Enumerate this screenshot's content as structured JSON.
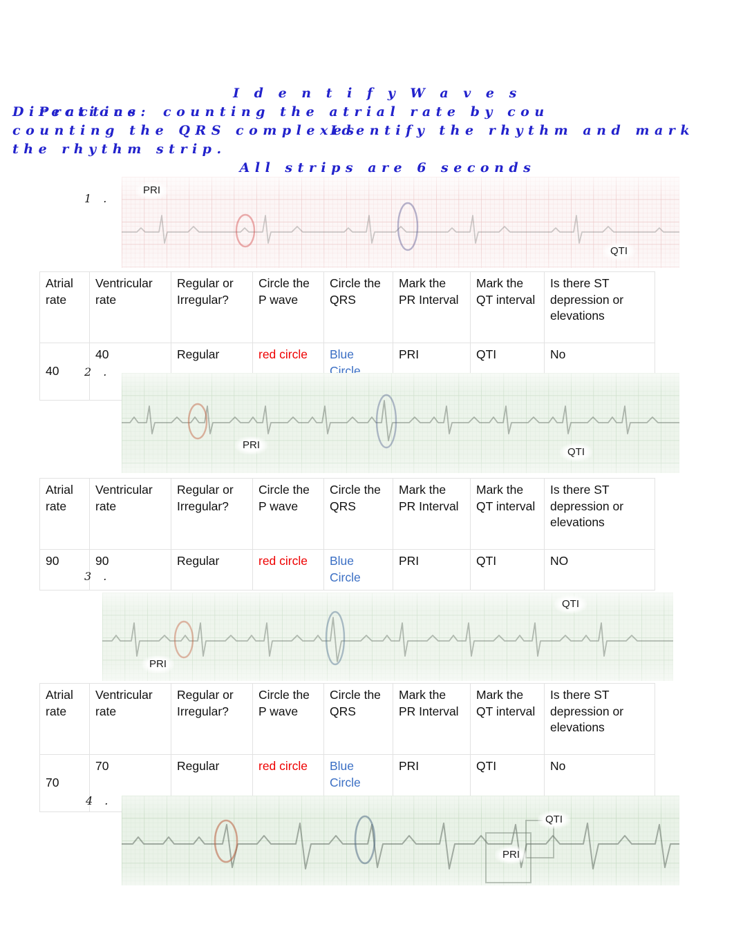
{
  "header": {
    "title": "I d e n t i f y   W a v e s",
    "directions_overlap_a": "Directions:",
    "directions_overlap_b": "Practice",
    "line1_rest": "counting the atrial rate by cou",
    "line2_a": "counting the QRS complexes",
    "line2_b": "Identify the rhythm and mark",
    "line2_lead": "counting  the  QRS  comple",
    "line3": "the rhythm strip.",
    "all_strips": "All strips are 6 seconds",
    "color_blue": "#2222cc"
  },
  "strips": [
    {
      "number": "1 .",
      "pri_label": "PRI",
      "qti_label": "QTI",
      "paper_color": "#f3dede"
    },
    {
      "number": "2 .",
      "pri_label": "PRI",
      "qti_label": "QTI",
      "paper_color": "#dfeadd"
    },
    {
      "number": "3 .",
      "pri_label": "PRI",
      "qti_label": "QTI",
      "paper_color": "#e2ece0"
    },
    {
      "number": "4 .",
      "pri_label": "PRI",
      "qti_label": "QTI",
      "paper_color": "#dfeadd"
    }
  ],
  "table_headers": [
    "Atrial rate",
    "Ventricular rate",
    "Regular or Irregular?",
    "Circle the P wave",
    "Circle the QRS",
    "Mark the PR Interval",
    "Mark the QT interval",
    "Is there ST depression or elevations"
  ],
  "tables": [
    {
      "atrial_rate": "40",
      "ventricular_rate": "40",
      "regularity": "Regular",
      "p_wave": "red circle",
      "qrs": "Blue Circle",
      "pr_interval": "PRI",
      "qt_interval": "QTI",
      "st": "No"
    },
    {
      "atrial_rate": "90",
      "ventricular_rate": "90",
      "regularity": "Regular",
      "p_wave": "red circle",
      "qrs": "Blue Circle",
      "pr_interval": "PRI",
      "qt_interval": "QTI",
      "st": "NO"
    },
    {
      "atrial_rate": "70",
      "ventricular_rate": "70",
      "regularity": "Regular",
      "p_wave": "red circle",
      "qrs": "Blue Circle",
      "pr_interval": "PRI",
      "qt_interval": "QTI",
      "st": "No"
    }
  ],
  "colors": {
    "p_wave_text": "#ee0000",
    "qrs_text": "#3b6fc4",
    "header_blue": "#2222cc",
    "table_border": "#e2e2e2"
  }
}
